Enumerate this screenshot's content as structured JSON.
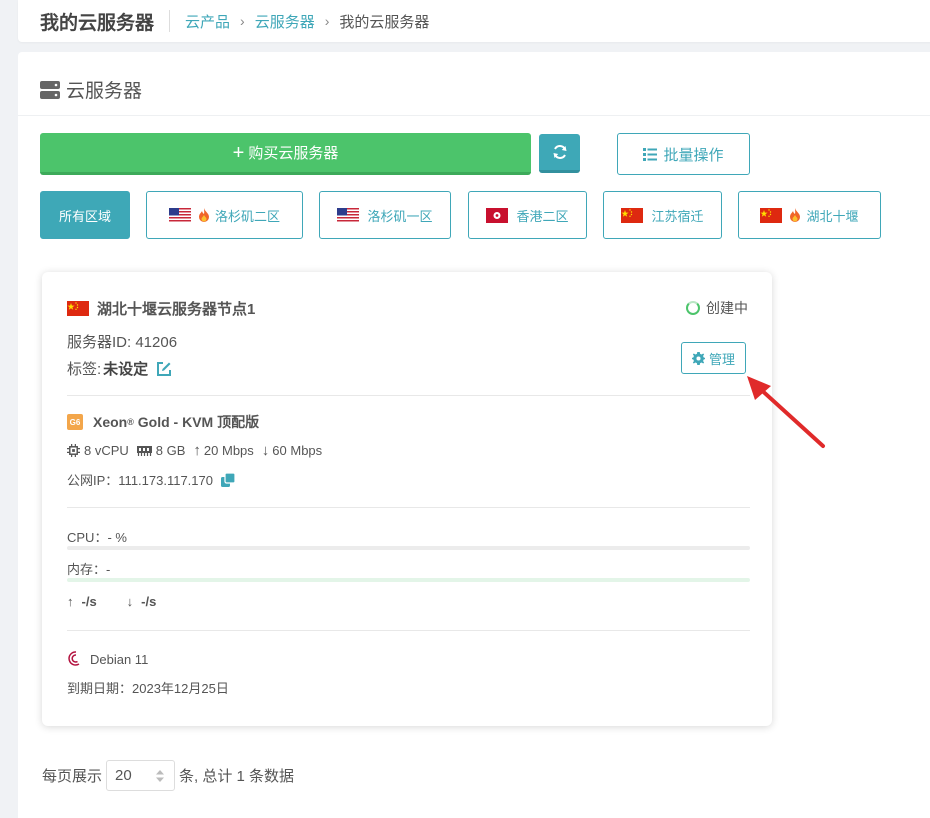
{
  "header": {
    "title": "我的云服务器",
    "breadcrumb": [
      "云产品",
      "云服务器",
      "我的云服务器"
    ]
  },
  "section": {
    "title": "云服务器"
  },
  "toolbar": {
    "buy_label": "购买云服务器",
    "batch_label": "批量操作"
  },
  "regions": [
    {
      "label": "所有区域",
      "active": true,
      "flag": "",
      "hot": false
    },
    {
      "label": "洛杉矶二区",
      "active": false,
      "flag": "us",
      "hot": true
    },
    {
      "label": "洛杉矶一区",
      "active": false,
      "flag": "us",
      "hot": false
    },
    {
      "label": "香港二区",
      "active": false,
      "flag": "hk",
      "hot": false
    },
    {
      "label": "江苏宿迁",
      "active": false,
      "flag": "cn",
      "hot": false
    },
    {
      "label": "湖北十堰",
      "active": false,
      "flag": "cn",
      "hot": true
    }
  ],
  "server": {
    "name": "湖北十堰云服务器节点1",
    "status": "创建中",
    "id_text": "服务器ID: 41206",
    "tag_label": "标签:",
    "tag_value": "未设定",
    "manage_label": "管理",
    "gen_badge": "G6",
    "cpu_model": "Xeon",
    "cpu_model_reg": "®",
    "cpu_model_rest": " Gold - KVM 顶配版",
    "vcpu": "8 vCPU",
    "ram": "8 GB",
    "up_bw": "20 Mbps",
    "down_bw": "60 Mbps",
    "ip_text": "公网IP：111.173.117.170",
    "cpu_text": "CPU：- %",
    "mem_text": "内存：-",
    "net_up": "-/s",
    "net_down": "-/s",
    "os": "Debian 11",
    "expire_text": "到期日期：2023年12月25日"
  },
  "pager": {
    "prefix": "每页展示",
    "page_size": "20",
    "suffix": "条, 总计 1 条数据"
  },
  "colors": {
    "accent": "#3fa7b8",
    "green": "#4cc46b",
    "annotation": "#e02a2a"
  }
}
